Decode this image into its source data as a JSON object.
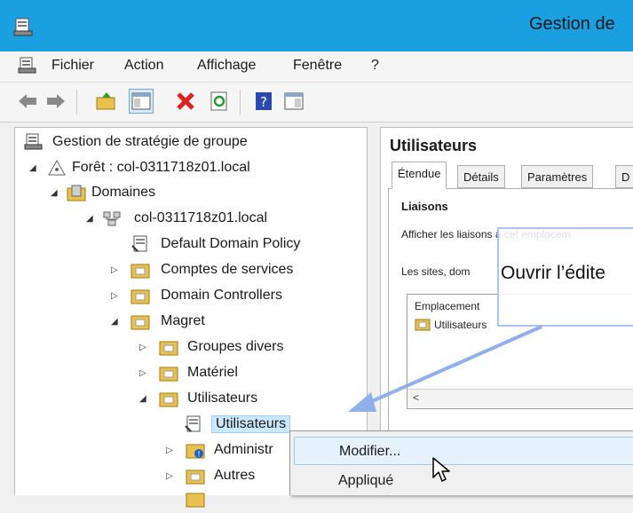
{
  "window": {
    "title": "Gestion de"
  },
  "menu": [
    "Fichier",
    "Action",
    "Affichage",
    "Fenêtre",
    "?"
  ],
  "tree": {
    "root": "Gestion de stratégie de groupe",
    "forest": "Forêt : col-0311718z01.local",
    "domains": "Domaines",
    "domain": "col-0311718z01.local",
    "default_policy": "Default Domain Policy",
    "service_accounts": "Comptes de services",
    "domain_controllers": "Domain Controllers",
    "magret": "Magret",
    "various_groups": "Groupes divers",
    "hardware": "Matériel",
    "users_ou": "Utilisateurs",
    "users_gpo": "Utilisateurs",
    "admin": "Administr",
    "others": "Autres"
  },
  "details": {
    "title": "Utilisateurs",
    "tabs": [
      "Étendue",
      "Détails",
      "Paramètres",
      "D"
    ],
    "links_heading": "Liaisons",
    "show_links": "Afficher les liaisons à cet emplacem",
    "sites_text": "Les sites, dom",
    "col_location": "Emplacement",
    "row_location": "Utilisateurs",
    "scroll_left": "<"
  },
  "tooltip": {
    "text": "Ouvrir l’édite"
  },
  "context_menu": {
    "items": [
      "Modifier...",
      "Appliqué"
    ]
  },
  "colors": {
    "titlebar": "#1aa0e0",
    "selection": "#cce8ff",
    "menu_hover": "#e5f1fb",
    "arrow": "#8fb0ea"
  }
}
